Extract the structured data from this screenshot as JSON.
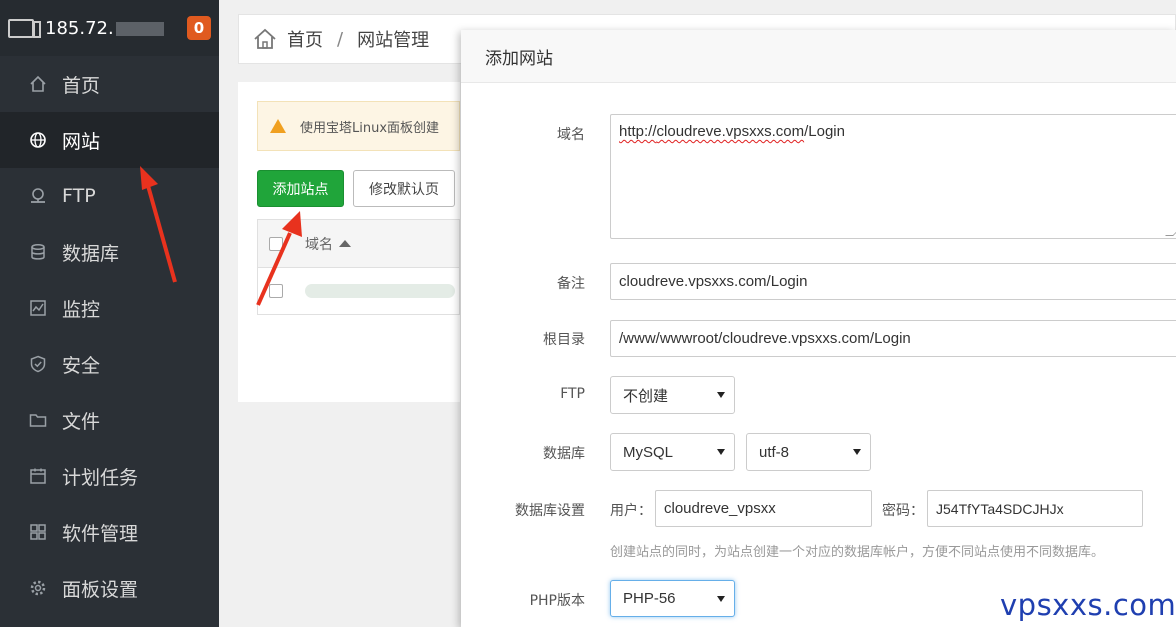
{
  "sidebar": {
    "server_ip": "185.72.",
    "notification_count": "0",
    "items": [
      {
        "label": "首页",
        "icon": "home-icon"
      },
      {
        "label": "网站",
        "icon": "globe-icon"
      },
      {
        "label": "FTP",
        "icon": "ftp-icon"
      },
      {
        "label": "数据库",
        "icon": "database-icon"
      },
      {
        "label": "监控",
        "icon": "monitor-icon"
      },
      {
        "label": "安全",
        "icon": "shield-icon"
      },
      {
        "label": "文件",
        "icon": "folder-icon"
      },
      {
        "label": "计划任务",
        "icon": "calendar-icon"
      },
      {
        "label": "软件管理",
        "icon": "apps-icon"
      },
      {
        "label": "面板设置",
        "icon": "gear-icon"
      }
    ],
    "active_item": "网站"
  },
  "breadcrumb": {
    "home": "首页",
    "current": "网站管理"
  },
  "site_page": {
    "notice": "使用宝塔Linux面板创建",
    "add_site_button": "添加站点",
    "default_page_button": "修改默认页",
    "table_header_domain": "域名"
  },
  "modal": {
    "title": "添加网站",
    "domain_label": "域名",
    "domain_value": "http://cloudreve.vpsxxs.com/Login",
    "domain_prefix": "http://",
    "domain_rest": "cloudreve.vpsxxs.com",
    "domain_suffix": "/Login",
    "remark_label": "备注",
    "remark_value": "cloudreve.vpsxxs.com/Login",
    "root_label": "根目录",
    "root_value": "/www/wwwroot/cloudreve.vpsxxs.com/Login",
    "ftp_label": "FTP",
    "ftp_value": "不创建",
    "db_label": "数据库",
    "db_type": "MySQL",
    "db_charset": "utf-8",
    "db_settings_label": "数据库设置",
    "db_user_label": "用户：",
    "db_user_value": "cloudreve_vpsxx",
    "db_password_label": "密码：",
    "db_password_value": "J54TfYTa4SDCJHJx",
    "db_hint": "创建站点的同时，为站点创建一个对应的数据库帐户，方便不同站点使用不同数据库。",
    "php_label": "PHP版本",
    "php_value": "PHP-56"
  },
  "watermark": "vpsxxs.com",
  "colors": {
    "accent_green": "#20a53a",
    "badge_orange": "#e05a1f",
    "sidebar_bg": "#2b3036",
    "annotation_red": "#e8321e"
  }
}
